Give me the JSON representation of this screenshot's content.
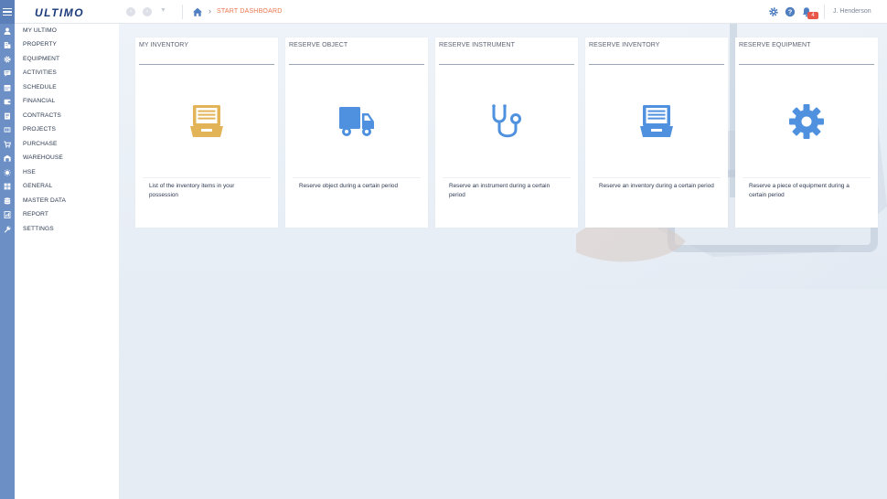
{
  "app": {
    "logo_text": "ULTIMO",
    "breadcrumb": "START DASHBOARD",
    "user_name": "J. Henderson",
    "notification_count": "4"
  },
  "sidebar": {
    "items": [
      {
        "label": "MY ULTIMO",
        "icon": "user-icon"
      },
      {
        "label": "PROPERTY",
        "icon": "building-icon"
      },
      {
        "label": "EQUIPMENT",
        "icon": "gear-icon"
      },
      {
        "label": "ACTIVITIES",
        "icon": "activities-icon"
      },
      {
        "label": "SCHEDULE",
        "icon": "calendar-icon"
      },
      {
        "label": "FINANCIAL",
        "icon": "wallet-icon"
      },
      {
        "label": "CONTRACTS",
        "icon": "contract-icon"
      },
      {
        "label": "PROJECTS",
        "icon": "projects-icon"
      },
      {
        "label": "PURCHASE",
        "icon": "cart-icon"
      },
      {
        "label": "WAREHOUSE",
        "icon": "warehouse-icon"
      },
      {
        "label": "HSE",
        "icon": "hse-icon"
      },
      {
        "label": "GENERAL",
        "icon": "grid-icon"
      },
      {
        "label": "MASTER DATA",
        "icon": "database-icon"
      },
      {
        "label": "REPORT",
        "icon": "report-icon"
      },
      {
        "label": "SETTINGS",
        "icon": "wrench-icon"
      }
    ]
  },
  "cards": [
    {
      "title": "MY INVENTORY",
      "description": "List of the inventory items in your possession",
      "icon": "inventory-drawer-icon",
      "color": "#e2b457"
    },
    {
      "title": "RESERVE OBJECT",
      "description": "Reserve object during a certain period",
      "icon": "truck-icon",
      "color": "#4f91df"
    },
    {
      "title": "RESERVE INSTRUMENT",
      "description": "Reserve an instrument during a certain period",
      "icon": "stethoscope-icon",
      "color": "#4f91df"
    },
    {
      "title": "RESERVE INVENTORY",
      "description": "Reserve an inventory during a certain period",
      "icon": "inventory-drawer-icon",
      "color": "#4f91df"
    },
    {
      "title": "RESERVE EQUIPMENT",
      "description": "Reserve a piece of equipment during a certain period",
      "icon": "gear-icon",
      "color": "#4f91df"
    }
  ],
  "colors": {
    "rail": "#6c8fc6",
    "accent_orange": "#e8774f",
    "icon_blue": "#4f91df",
    "icon_gold": "#e2b457",
    "badge_red": "#e8574a"
  }
}
